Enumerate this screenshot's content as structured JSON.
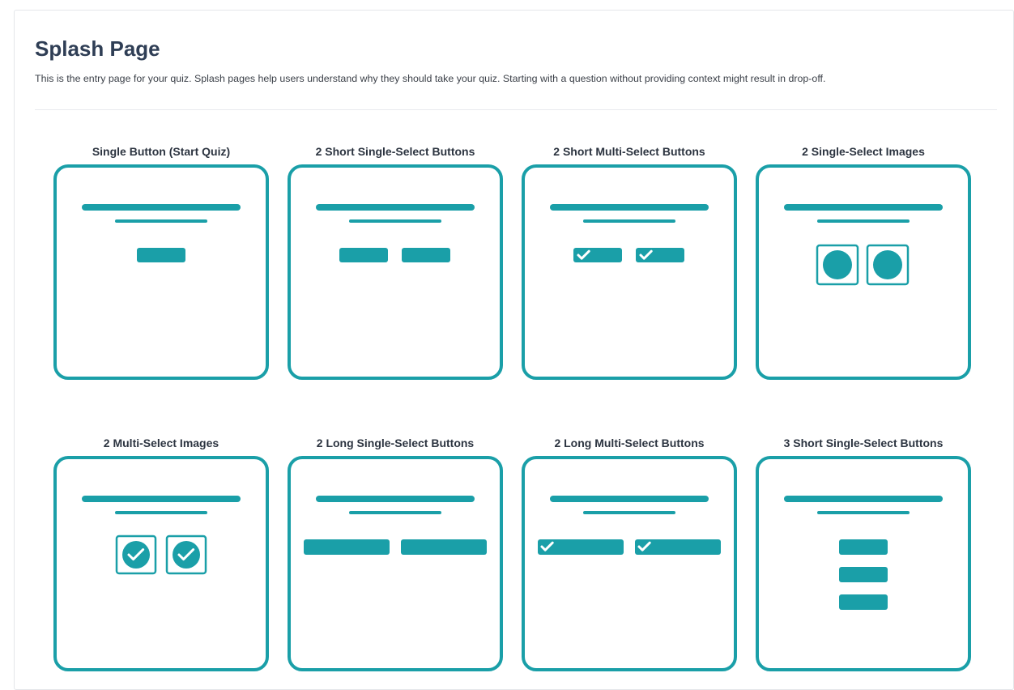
{
  "header": {
    "title": "Splash Page",
    "description": "This is the entry page for your quiz. Splash pages help users understand why they should take your quiz. Starting with a question without providing context might result in drop-off."
  },
  "colors": {
    "accent": "#1a9fa8",
    "heading": "#2f3e55",
    "text": "#3a3f47",
    "border": "#e4e6ea"
  },
  "layouts": [
    {
      "id": "single-button",
      "label": "Single Button (Start Quiz)",
      "kind": "single-button",
      "icon": "single-button-layout-icon"
    },
    {
      "id": "2-short-single-select-buttons",
      "label": "2 Short Single-Select Buttons",
      "kind": "two-short-buttons",
      "icon": "two-short-buttons-layout-icon"
    },
    {
      "id": "2-short-multi-select-buttons",
      "label": "2 Short Multi-Select Buttons",
      "kind": "two-short-check-buttons",
      "icon": "two-short-check-buttons-layout-icon"
    },
    {
      "id": "2-single-select-images",
      "label": "2 Single-Select Images",
      "kind": "two-images",
      "icon": "two-images-layout-icon"
    },
    {
      "id": "2-multi-select-images",
      "label": "2 Multi-Select Images",
      "kind": "two-check-images",
      "icon": "two-check-images-layout-icon"
    },
    {
      "id": "2-long-single-select-buttons",
      "label": "2 Long Single-Select Buttons",
      "kind": "two-long-buttons",
      "icon": "two-long-buttons-layout-icon"
    },
    {
      "id": "2-long-multi-select-buttons",
      "label": "2 Long Multi-Select Buttons",
      "kind": "two-long-check-buttons",
      "icon": "two-long-check-buttons-layout-icon"
    },
    {
      "id": "3-short-single-select-buttons",
      "label": "3 Short Single-Select Buttons",
      "kind": "three-short-buttons",
      "icon": "three-short-buttons-layout-icon"
    }
  ]
}
